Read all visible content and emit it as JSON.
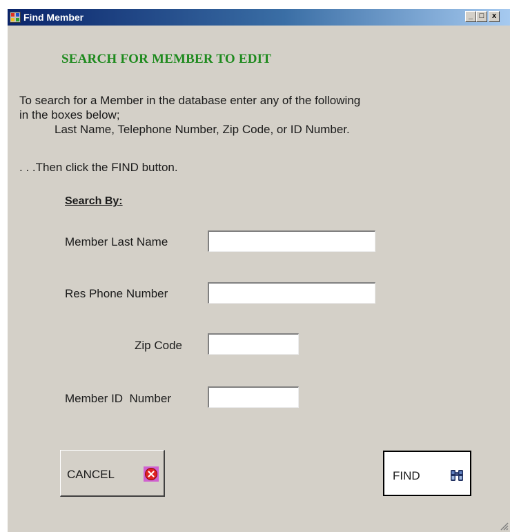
{
  "window": {
    "title": "Find Member",
    "controls": {
      "minimize": "_",
      "maximize": "□",
      "close": "x"
    }
  },
  "heading": "SEARCH FOR MEMBER TO EDIT",
  "instructions": {
    "line1": "To search for a Member in the database enter any of the following",
    "line2": "in the boxes below;",
    "line3": "Last Name, Telephone Number, Zip Code, or ID Number.",
    "line4": ". . .Then click the FIND button."
  },
  "search_by_label": "Search By:",
  "fields": [
    {
      "label": "Member Last Name",
      "value": ""
    },
    {
      "label": "Res Phone Number",
      "value": ""
    },
    {
      "label": "Zip Code",
      "value": ""
    },
    {
      "label": "Member ID  Number",
      "value": ""
    }
  ],
  "buttons": {
    "cancel": {
      "label": "CANCEL",
      "icon": "cancel-x-icon"
    },
    "find": {
      "label": "FIND",
      "icon": "binoculars-icon"
    }
  },
  "colors": {
    "heading": "#1e8a1e",
    "window_bg": "#d4d0c8",
    "titlebar_start": "#0a246a",
    "titlebar_end": "#a6caf0"
  }
}
